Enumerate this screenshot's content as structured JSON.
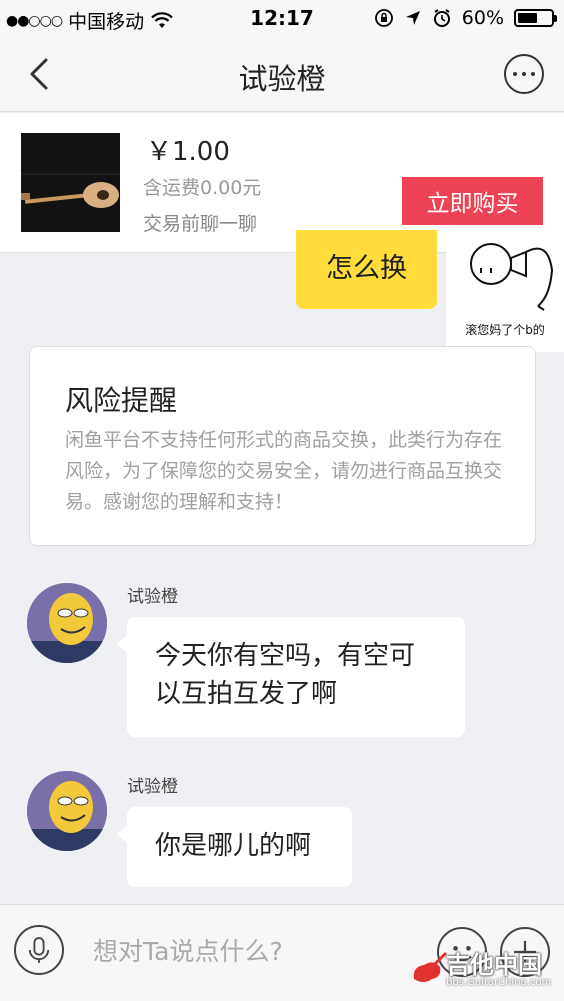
{
  "status_bar": {
    "carrier": "中国移动",
    "time": "12:17",
    "battery": "60%",
    "battery_level": 0.6
  },
  "nav": {
    "title": "试验橙"
  },
  "product": {
    "price": "￥1.00",
    "shipping": "含运费0.00元",
    "chat_hint": "交易前聊一聊",
    "buy_label": "立即购买"
  },
  "sticker": {
    "caption": "滚您妈了个b的"
  },
  "messages": {
    "sent_text": "怎么换",
    "risk_title": "风险提醒",
    "risk_body": "闲鱼平台不支持任何形式的商品交换，此类行为存在风险，为了保障您的交易安全，请勿进行商品互换交易。感谢您的理解和支持！",
    "incoming": [
      {
        "sender": "试验橙",
        "text_line1": "今天你有空吗，有空可",
        "text_line2": "以互拍互发了啊"
      },
      {
        "sender": "试验橙",
        "text_line1": "你是哪儿的啊"
      }
    ]
  },
  "input": {
    "placeholder": "想对Ta说点什么?"
  },
  "watermark": {
    "text": "吉他中国",
    "url": "bbs.GuitarChina.com"
  }
}
